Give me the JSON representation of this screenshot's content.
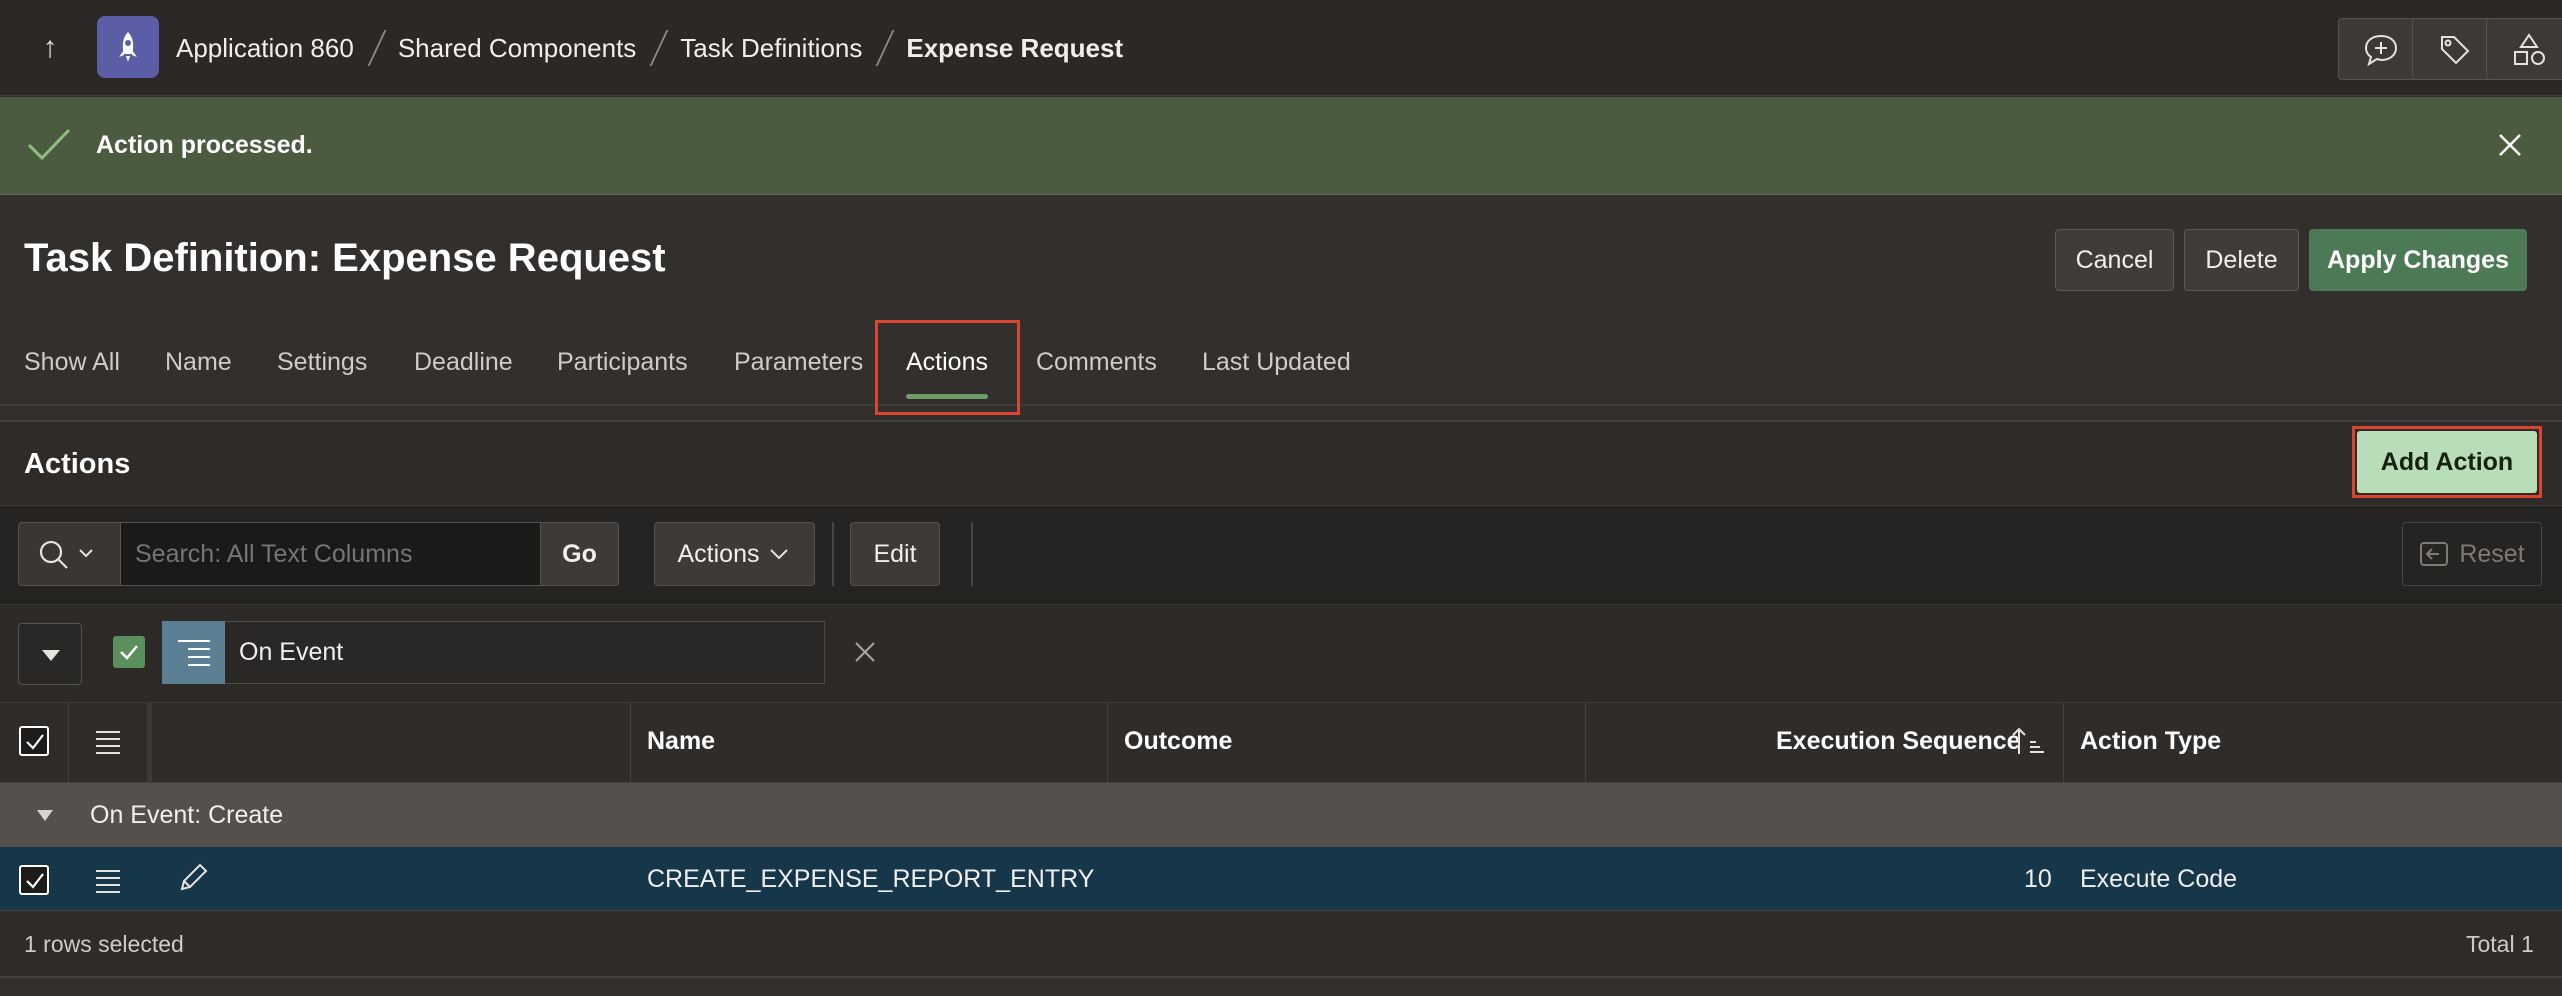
{
  "breadcrumb": {
    "items": [
      "Application 860",
      "Shared Components",
      "Task Definitions"
    ],
    "current": "Expense Request"
  },
  "banner": {
    "message": "Action processed."
  },
  "page": {
    "title": "Task Definition: Expense Request"
  },
  "header_buttons": {
    "cancel": "Cancel",
    "delete": "Delete",
    "apply": "Apply Changes"
  },
  "tabs": [
    {
      "label": "Show All"
    },
    {
      "label": "Name"
    },
    {
      "label": "Settings"
    },
    {
      "label": "Deadline"
    },
    {
      "label": "Participants"
    },
    {
      "label": "Parameters"
    },
    {
      "label": "Actions",
      "active": true
    },
    {
      "label": "Comments"
    },
    {
      "label": "Last Updated"
    }
  ],
  "region": {
    "title": "Actions",
    "add_button": "Add Action"
  },
  "toolbar": {
    "search_placeholder": "Search: All Text Columns",
    "go": "Go",
    "actions_menu": "Actions",
    "edit": "Edit",
    "reset": "Reset"
  },
  "filter": {
    "label": "On Event"
  },
  "grid": {
    "columns": [
      "Name",
      "Outcome",
      "Execution Sequence",
      "Action Type"
    ],
    "group_label": "On Event: Create",
    "rows": [
      {
        "name": "CREATE_EXPENSE_REPORT_ENTRY",
        "outcome": "",
        "sequence": "10",
        "action_type": "Execute Code",
        "selected": true
      }
    ],
    "footer_selected": "1 rows selected",
    "footer_total": "Total 1"
  },
  "colors": {
    "banner_bg": "#4b5b40",
    "primary_green": "#4b7a55",
    "add_action_bg": "#b9dcb9",
    "highlight_red": "#d9452f",
    "selected_row": "#16364a"
  },
  "icons": [
    "up-arrow-icon",
    "app-rocket-icon",
    "comment-add-icon",
    "tag-icon",
    "shapes-icon",
    "check-icon",
    "close-icon",
    "search-icon",
    "chevron-down-icon",
    "filter-lines-icon",
    "pencil-icon",
    "reset-icon",
    "sort-ascending-icon"
  ]
}
